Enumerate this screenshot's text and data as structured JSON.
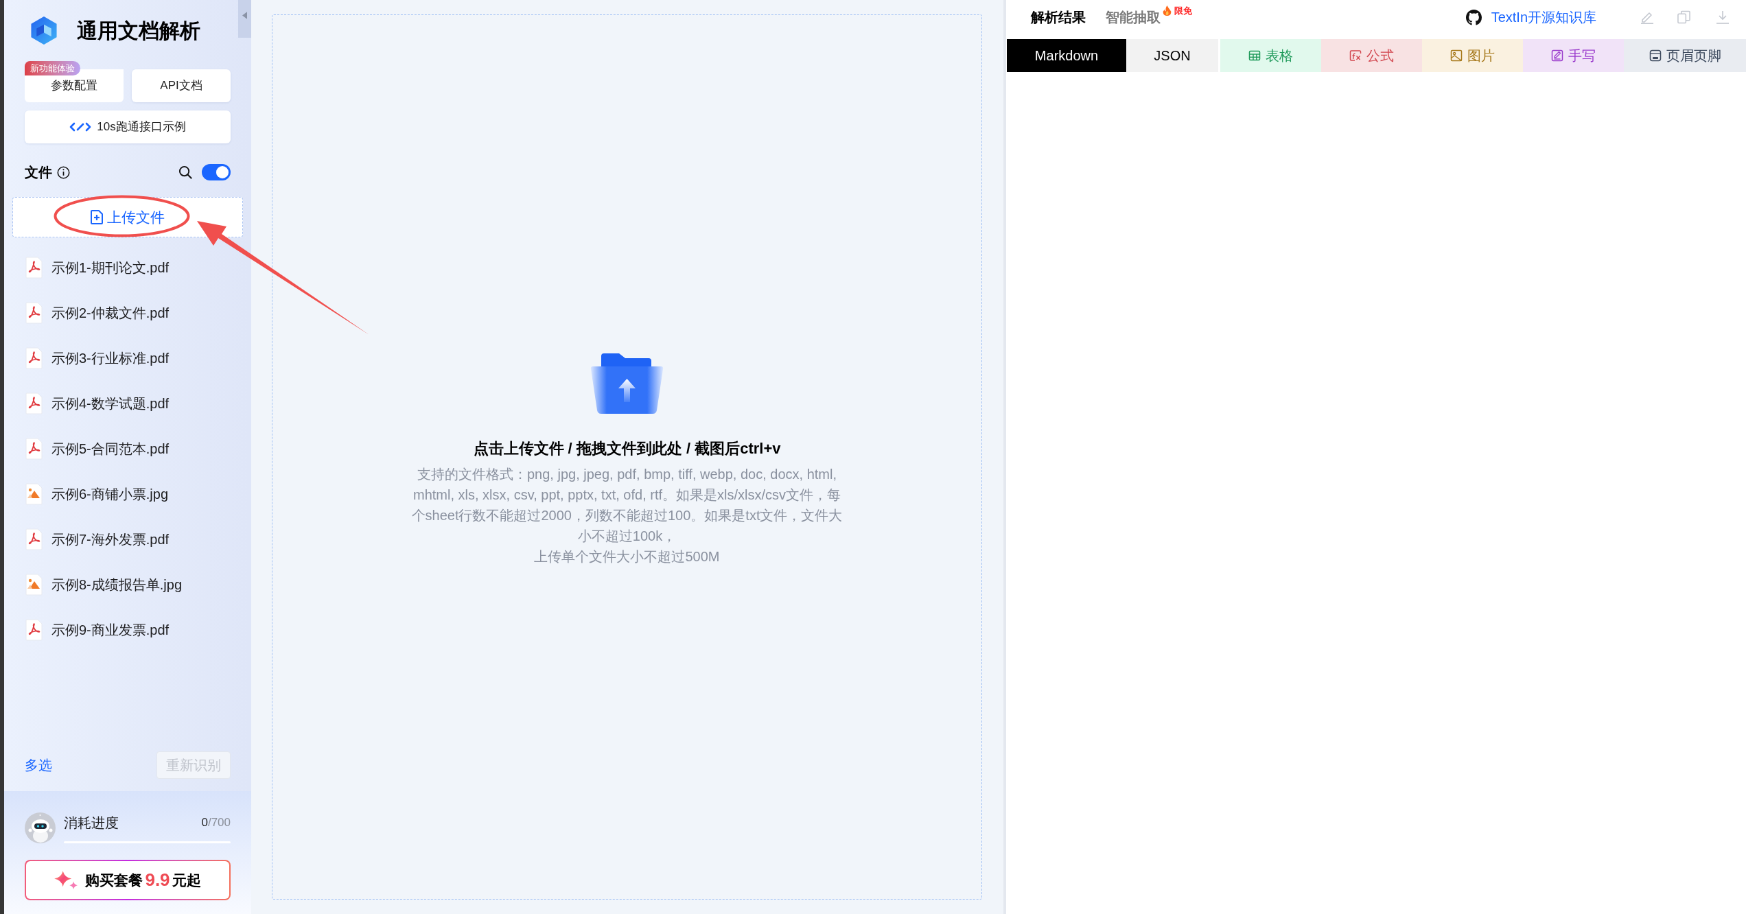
{
  "app": {
    "title": "通用文档解析"
  },
  "sidebar": {
    "buttons": [
      {
        "label": "参数配置",
        "badge": "新功能体验"
      },
      {
        "label": "API文档"
      }
    ],
    "example_button": {
      "label": "10s跑通接口示例"
    },
    "files_header": {
      "title": "文件",
      "toggle": {
        "on": true
      }
    },
    "upload_button": {
      "label": "上传文件",
      "circled": true,
      "pointed_at": true
    },
    "files": [
      {
        "name": "示例1-期刊论文.pdf",
        "kind": "pdf"
      },
      {
        "name": "示例2-仲裁文件.pdf",
        "kind": "pdf"
      },
      {
        "name": "示例3-行业标准.pdf",
        "kind": "pdf"
      },
      {
        "name": "示例4-数学试题.pdf",
        "kind": "pdf"
      },
      {
        "name": "示例5-合同范本.pdf",
        "kind": "pdf"
      },
      {
        "name": "示例6-商铺小票.jpg",
        "kind": "image"
      },
      {
        "name": "示例7-海外发票.pdf",
        "kind": "pdf"
      },
      {
        "name": "示例8-成绩报告单.jpg",
        "kind": "image"
      },
      {
        "name": "示例9-商业发票.pdf",
        "kind": "pdf"
      }
    ],
    "multi_select": {
      "label": "多选"
    },
    "reprocess_button": {
      "label": "重新识别",
      "disabled": true
    },
    "usage": {
      "label": "消耗进度",
      "used": "0",
      "total": "/700",
      "level": 0
    },
    "buy_button": {
      "label": "购买套餐",
      "price": "9.9",
      "suffix": "元起"
    }
  },
  "upload_area": {
    "title": "点击上传文件 / 拖拽文件到此处 / 截图后ctrl+v",
    "formats": "支持的文件格式：png, jpg, jpeg, pdf, bmp, tiff, webp, doc, docx, html, mhtml, xls, xlsx, csv, ppt, pptx, txt, ofd, rtf。如果是xls/xlsx/csv文件，每个sheet行数不能超过2000，列数不能超过100。如果是txt文件，文件大小不超过100k，",
    "size_limit": "上传单个文件大小不超过500M"
  },
  "result_panel": {
    "tabs": [
      {
        "label": "解析结果",
        "selected": true
      },
      {
        "label": "智能抽取",
        "selected": false,
        "badge": "限免"
      }
    ],
    "repo_link": "TextIn开源知识库",
    "view_tabs": [
      {
        "label": "Markdown",
        "kind": "plain",
        "color": "#000000",
        "selected": true
      },
      {
        "label": "JSON",
        "kind": "plain",
        "color": "#000000",
        "selected": false
      },
      {
        "label": "表格",
        "kind": "table",
        "color": "#1f9a5a",
        "selected": false
      },
      {
        "label": "公式",
        "kind": "formula",
        "color": "#d2474f",
        "selected": false
      },
      {
        "label": "图片",
        "kind": "image",
        "color": "#a6781a",
        "selected": false
      },
      {
        "label": "手写",
        "kind": "handwriting",
        "color": "#9b3ccc",
        "selected": false
      },
      {
        "label": "页眉页脚",
        "kind": "header",
        "color": "#3d4a5e",
        "selected": false
      }
    ]
  }
}
